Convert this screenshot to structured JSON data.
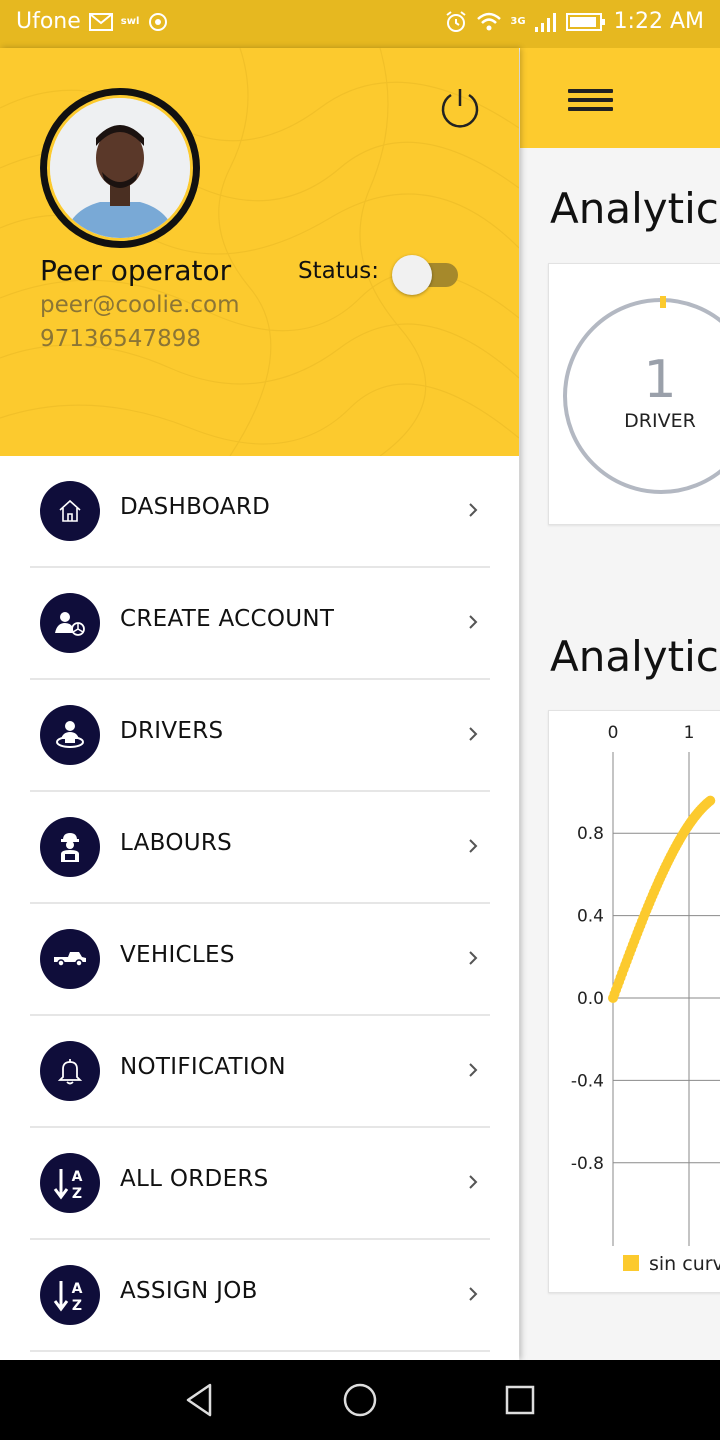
{
  "status_bar": {
    "carrier": "Ufone",
    "swl": "swl",
    "network": "3G",
    "time": "1:22 AM"
  },
  "drawer": {
    "user": {
      "name": "Peer operator",
      "email": "peer@coolie.com",
      "phone": "97136547898"
    },
    "status_label": "Status:",
    "status_on": false,
    "menu": [
      {
        "label": "DASHBOARD",
        "icon": "home-icon"
      },
      {
        "label": "CREATE ACCOUNT",
        "icon": "add-driver-icon"
      },
      {
        "label": "DRIVERS",
        "icon": "driver-icon"
      },
      {
        "label": "LABOURS",
        "icon": "worker-icon"
      },
      {
        "label": "VEHICLES",
        "icon": "pickup-truck-icon"
      },
      {
        "label": "NOTIFICATION",
        "icon": "bell-icon"
      },
      {
        "label": "ALL ORDERS",
        "icon": "sort-az-icon"
      },
      {
        "label": "ASSIGN JOB",
        "icon": "sort-az-icon"
      }
    ]
  },
  "background_app": {
    "section1_title": "Analytics",
    "section2_title": "Analytics",
    "gauge": {
      "value": "1",
      "label": "DRIVER"
    },
    "colors": {
      "accent": "#fcca2e",
      "icon_bg": "#0f0d3a"
    }
  },
  "chart_data": {
    "type": "line",
    "series": [
      {
        "name": "sin curve"
      }
    ],
    "x_ticks": [
      "0",
      "1"
    ],
    "y_ticks": [
      "0.8",
      "0.4",
      "0.0",
      "-0.4",
      "-0.8"
    ],
    "x_range_visible": [
      0,
      1.3
    ],
    "ylim": [
      -1.2,
      1.2
    ],
    "grid": true,
    "legend_position": "bottom"
  }
}
